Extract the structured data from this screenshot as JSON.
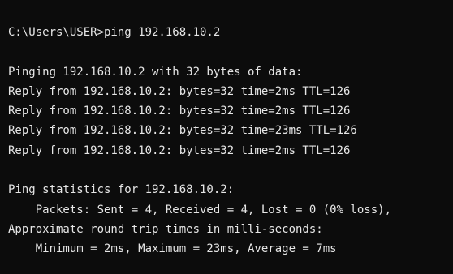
{
  "terminal": {
    "prompt_line": "C:\\Users\\USER>ping 192.168.10.2",
    "pinging_line": "Pinging 192.168.10.2 with 32 bytes of data:",
    "replies": [
      "Reply from 192.168.10.2: bytes=32 time=2ms TTL=126",
      "Reply from 192.168.10.2: bytes=32 time=2ms TTL=126",
      "Reply from 192.168.10.2: bytes=32 time=23ms TTL=126",
      "Reply from 192.168.10.2: bytes=32 time=2ms TTL=126"
    ],
    "stats_header": "Ping statistics for 192.168.10.2:",
    "packets_line": "    Packets: Sent = 4, Received = 4, Lost = 0 (0% loss),",
    "rtt_header": "Approximate round trip times in milli-seconds:",
    "rtt_line": "    Minimum = 2ms, Maximum = 23ms, Average = 7ms"
  },
  "colors": {
    "background": "#0c0c0c",
    "foreground": "#e6e6e6"
  }
}
